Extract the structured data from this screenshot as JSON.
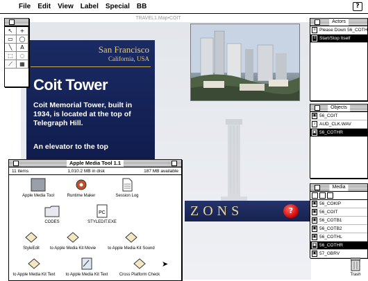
{
  "menubar": {
    "items": [
      "File",
      "Edit",
      "View",
      "Label",
      "Special",
      "BB"
    ],
    "help_icon": "?"
  },
  "stage": {
    "window_title": "TRAVEL1.Map•COIT",
    "city": "San Francisco",
    "region": "California, USA",
    "headline": "Coit Tower",
    "description": "Coit Memorial Tower, built in 1934, is located at the top of Telegraph Hill.",
    "elevator_text": "An elevator to the top",
    "banner_text": "ZONS",
    "help_button": "?"
  },
  "tools": {
    "icons": [
      "arrow-icon",
      "crosshair-icon",
      "rectangle-icon",
      "oval-icon",
      "line-icon",
      "text-icon",
      "rect-select-icon",
      "lasso-icon",
      "slant-icon",
      "paint-icon"
    ],
    "glyphs": [
      "↖",
      "+",
      "▭",
      "◯",
      "╲",
      "A",
      "⬚",
      "◌",
      "⟋",
      "▦"
    ]
  },
  "actors": {
    "title": "Actors",
    "items": [
      {
        "label": "Please Down 56_COTHR",
        "selected": false
      },
      {
        "label": "Start/Stop Itself",
        "selected": true
      }
    ]
  },
  "objects": {
    "title": "Objects",
    "items": [
      {
        "label": "56_COIT",
        "selected": false
      },
      {
        "label": "AUD_CLK.WAV",
        "selected": false
      },
      {
        "label": "56_COTHR",
        "selected": true
      }
    ]
  },
  "media": {
    "title": "Media",
    "items": [
      {
        "label": "56_COKIP",
        "selected": false
      },
      {
        "label": "56_COIT",
        "selected": false
      },
      {
        "label": "56_COTB1",
        "selected": false
      },
      {
        "label": "56_COTB2",
        "selected": false
      },
      {
        "label": "56_COTHL",
        "selected": false
      },
      {
        "label": "56_COTHR",
        "selected": true
      },
      {
        "label": "57_GBRV",
        "selected": false
      }
    ]
  },
  "finder": {
    "title": "Apple Media Tool 1.1",
    "item_count": "11 items",
    "disk_used": "1,010.2 MB in disk",
    "available": "187 MB available",
    "icons": [
      {
        "label": "Apple Media Tool",
        "type": "app"
      },
      {
        "label": "Runtime Maker",
        "type": "gear"
      },
      {
        "label": "Session Log",
        "type": "doc"
      },
      {
        "label": "CODES",
        "type": "folder"
      },
      {
        "label": "STYLEDIT.EXE",
        "type": "pc"
      },
      {
        "label": "StyleEdit",
        "type": "alias"
      },
      {
        "label": "to Apple Media Kit Movie",
        "type": "alias"
      },
      {
        "label": "to Apple Media Kit Sound",
        "type": "alias"
      },
      {
        "label": "to Apple Media Kit Text",
        "type": "alias"
      },
      {
        "label": "to Apple Media Kit Text",
        "type": "alias2"
      },
      {
        "label": "Cross Platform Check",
        "type": "alias"
      }
    ]
  },
  "desktop": {
    "trash_label": "Trash"
  },
  "colors": {
    "panel_blue": "#1a2b63",
    "gold_text": "#e9c97a",
    "help_red": "#cc0000"
  }
}
